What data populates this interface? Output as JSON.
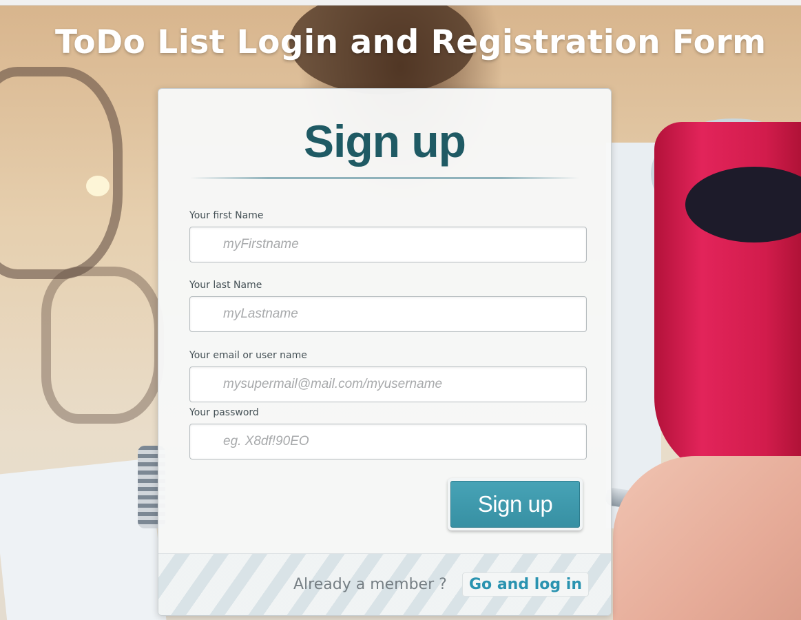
{
  "page": {
    "title": "ToDo List Login and Registration Form"
  },
  "signup": {
    "title": "Sign up",
    "fields": [
      {
        "label": "Your first Name",
        "placeholder": "myFirstname",
        "value": ""
      },
      {
        "label": "Your last Name",
        "placeholder": "myLastname",
        "value": ""
      },
      {
        "label": "Your email or user name",
        "placeholder": "mysupermail@mail.com/myusername",
        "value": ""
      },
      {
        "label": "Your password",
        "placeholder": "eg. X8df!90EO",
        "value": ""
      }
    ],
    "submit_label": "Sign up"
  },
  "footer": {
    "member_text": "Already a member ?",
    "login_link": "Go and log in"
  },
  "colors": {
    "title_text": "#ffffff",
    "card_title": "#1f5a64",
    "button": "#3b96a9",
    "link": "#2a93b0"
  }
}
